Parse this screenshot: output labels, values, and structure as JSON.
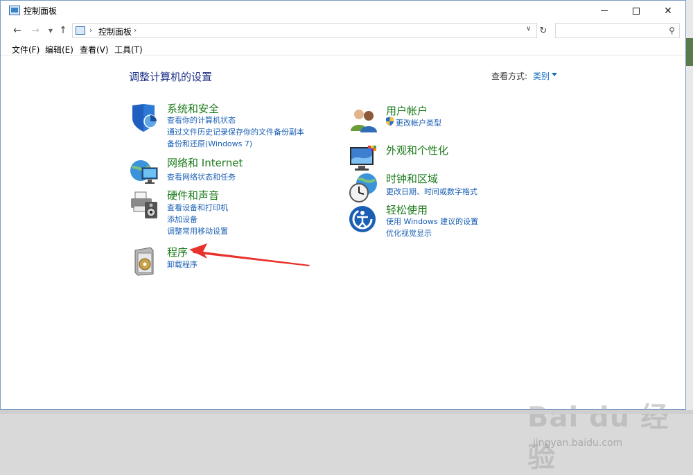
{
  "window": {
    "title": "控制面板"
  },
  "address": {
    "path": "控制面板",
    "search_placeholder": ""
  },
  "menu": {
    "items": [
      "文件(F)",
      "编辑(E)",
      "查看(V)",
      "工具(T)"
    ]
  },
  "page": {
    "title": "调整计算机的设置",
    "viewby_label": "查看方式:",
    "viewby_value": "类别"
  },
  "categories": {
    "security": {
      "title": "系统和安全",
      "links": [
        "查看你的计算机状态",
        "通过文件历史记录保存你的文件备份副本",
        "备份和还原(Windows 7)"
      ]
    },
    "network": {
      "title": "网络和 Internet",
      "links": [
        "查看网络状态和任务"
      ]
    },
    "hardware": {
      "title": "硬件和声音",
      "links": [
        "查看设备和打印机",
        "添加设备",
        "调整常用移动设置"
      ]
    },
    "programs": {
      "title": "程序",
      "links": [
        "卸载程序"
      ]
    },
    "users": {
      "title": "用户帐户",
      "links": [
        "更改帐户类型"
      ]
    },
    "appearance": {
      "title": "外观和个性化",
      "links": []
    },
    "clock": {
      "title": "时钟和区域",
      "links": [
        "更改日期、时间或数字格式"
      ]
    },
    "ease": {
      "title": "轻松使用",
      "links": [
        "使用 Windows 建议的设置",
        "优化视觉显示"
      ]
    }
  },
  "watermark": {
    "text": "Bai du 经验",
    "sub": "jingyan.baidu.com"
  },
  "colors": {
    "link": "#1a5fb4",
    "category_title": "#1a7a1a",
    "annotation_arrow": "#e8322c"
  },
  "icons": {
    "security": "shield-icon",
    "network": "globe-monitor-icon",
    "hardware": "printer-speaker-icon",
    "programs": "program-disc-icon",
    "users": "users-icon",
    "appearance": "monitor-palette-icon",
    "clock": "clock-globe-icon",
    "ease": "ease-of-access-icon"
  }
}
